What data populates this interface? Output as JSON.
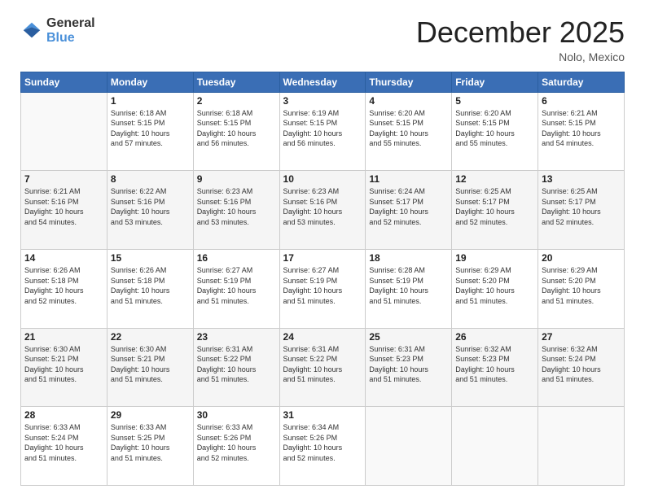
{
  "header": {
    "logo_line1": "General",
    "logo_line2": "Blue",
    "month": "December 2025",
    "location": "Nolo, Mexico"
  },
  "weekdays": [
    "Sunday",
    "Monday",
    "Tuesday",
    "Wednesday",
    "Thursday",
    "Friday",
    "Saturday"
  ],
  "weeks": [
    [
      {
        "day": "",
        "info": ""
      },
      {
        "day": "1",
        "info": "Sunrise: 6:18 AM\nSunset: 5:15 PM\nDaylight: 10 hours\nand 57 minutes."
      },
      {
        "day": "2",
        "info": "Sunrise: 6:18 AM\nSunset: 5:15 PM\nDaylight: 10 hours\nand 56 minutes."
      },
      {
        "day": "3",
        "info": "Sunrise: 6:19 AM\nSunset: 5:15 PM\nDaylight: 10 hours\nand 56 minutes."
      },
      {
        "day": "4",
        "info": "Sunrise: 6:20 AM\nSunset: 5:15 PM\nDaylight: 10 hours\nand 55 minutes."
      },
      {
        "day": "5",
        "info": "Sunrise: 6:20 AM\nSunset: 5:15 PM\nDaylight: 10 hours\nand 55 minutes."
      },
      {
        "day": "6",
        "info": "Sunrise: 6:21 AM\nSunset: 5:15 PM\nDaylight: 10 hours\nand 54 minutes."
      }
    ],
    [
      {
        "day": "7",
        "info": "Sunrise: 6:21 AM\nSunset: 5:16 PM\nDaylight: 10 hours\nand 54 minutes."
      },
      {
        "day": "8",
        "info": "Sunrise: 6:22 AM\nSunset: 5:16 PM\nDaylight: 10 hours\nand 53 minutes."
      },
      {
        "day": "9",
        "info": "Sunrise: 6:23 AM\nSunset: 5:16 PM\nDaylight: 10 hours\nand 53 minutes."
      },
      {
        "day": "10",
        "info": "Sunrise: 6:23 AM\nSunset: 5:16 PM\nDaylight: 10 hours\nand 53 minutes."
      },
      {
        "day": "11",
        "info": "Sunrise: 6:24 AM\nSunset: 5:17 PM\nDaylight: 10 hours\nand 52 minutes."
      },
      {
        "day": "12",
        "info": "Sunrise: 6:25 AM\nSunset: 5:17 PM\nDaylight: 10 hours\nand 52 minutes."
      },
      {
        "day": "13",
        "info": "Sunrise: 6:25 AM\nSunset: 5:17 PM\nDaylight: 10 hours\nand 52 minutes."
      }
    ],
    [
      {
        "day": "14",
        "info": "Sunrise: 6:26 AM\nSunset: 5:18 PM\nDaylight: 10 hours\nand 52 minutes."
      },
      {
        "day": "15",
        "info": "Sunrise: 6:26 AM\nSunset: 5:18 PM\nDaylight: 10 hours\nand 51 minutes."
      },
      {
        "day": "16",
        "info": "Sunrise: 6:27 AM\nSunset: 5:19 PM\nDaylight: 10 hours\nand 51 minutes."
      },
      {
        "day": "17",
        "info": "Sunrise: 6:27 AM\nSunset: 5:19 PM\nDaylight: 10 hours\nand 51 minutes."
      },
      {
        "day": "18",
        "info": "Sunrise: 6:28 AM\nSunset: 5:19 PM\nDaylight: 10 hours\nand 51 minutes."
      },
      {
        "day": "19",
        "info": "Sunrise: 6:29 AM\nSunset: 5:20 PM\nDaylight: 10 hours\nand 51 minutes."
      },
      {
        "day": "20",
        "info": "Sunrise: 6:29 AM\nSunset: 5:20 PM\nDaylight: 10 hours\nand 51 minutes."
      }
    ],
    [
      {
        "day": "21",
        "info": "Sunrise: 6:30 AM\nSunset: 5:21 PM\nDaylight: 10 hours\nand 51 minutes."
      },
      {
        "day": "22",
        "info": "Sunrise: 6:30 AM\nSunset: 5:21 PM\nDaylight: 10 hours\nand 51 minutes."
      },
      {
        "day": "23",
        "info": "Sunrise: 6:31 AM\nSunset: 5:22 PM\nDaylight: 10 hours\nand 51 minutes."
      },
      {
        "day": "24",
        "info": "Sunrise: 6:31 AM\nSunset: 5:22 PM\nDaylight: 10 hours\nand 51 minutes."
      },
      {
        "day": "25",
        "info": "Sunrise: 6:31 AM\nSunset: 5:23 PM\nDaylight: 10 hours\nand 51 minutes."
      },
      {
        "day": "26",
        "info": "Sunrise: 6:32 AM\nSunset: 5:23 PM\nDaylight: 10 hours\nand 51 minutes."
      },
      {
        "day": "27",
        "info": "Sunrise: 6:32 AM\nSunset: 5:24 PM\nDaylight: 10 hours\nand 51 minutes."
      }
    ],
    [
      {
        "day": "28",
        "info": "Sunrise: 6:33 AM\nSunset: 5:24 PM\nDaylight: 10 hours\nand 51 minutes."
      },
      {
        "day": "29",
        "info": "Sunrise: 6:33 AM\nSunset: 5:25 PM\nDaylight: 10 hours\nand 51 minutes."
      },
      {
        "day": "30",
        "info": "Sunrise: 6:33 AM\nSunset: 5:26 PM\nDaylight: 10 hours\nand 52 minutes."
      },
      {
        "day": "31",
        "info": "Sunrise: 6:34 AM\nSunset: 5:26 PM\nDaylight: 10 hours\nand 52 minutes."
      },
      {
        "day": "",
        "info": ""
      },
      {
        "day": "",
        "info": ""
      },
      {
        "day": "",
        "info": ""
      }
    ]
  ]
}
